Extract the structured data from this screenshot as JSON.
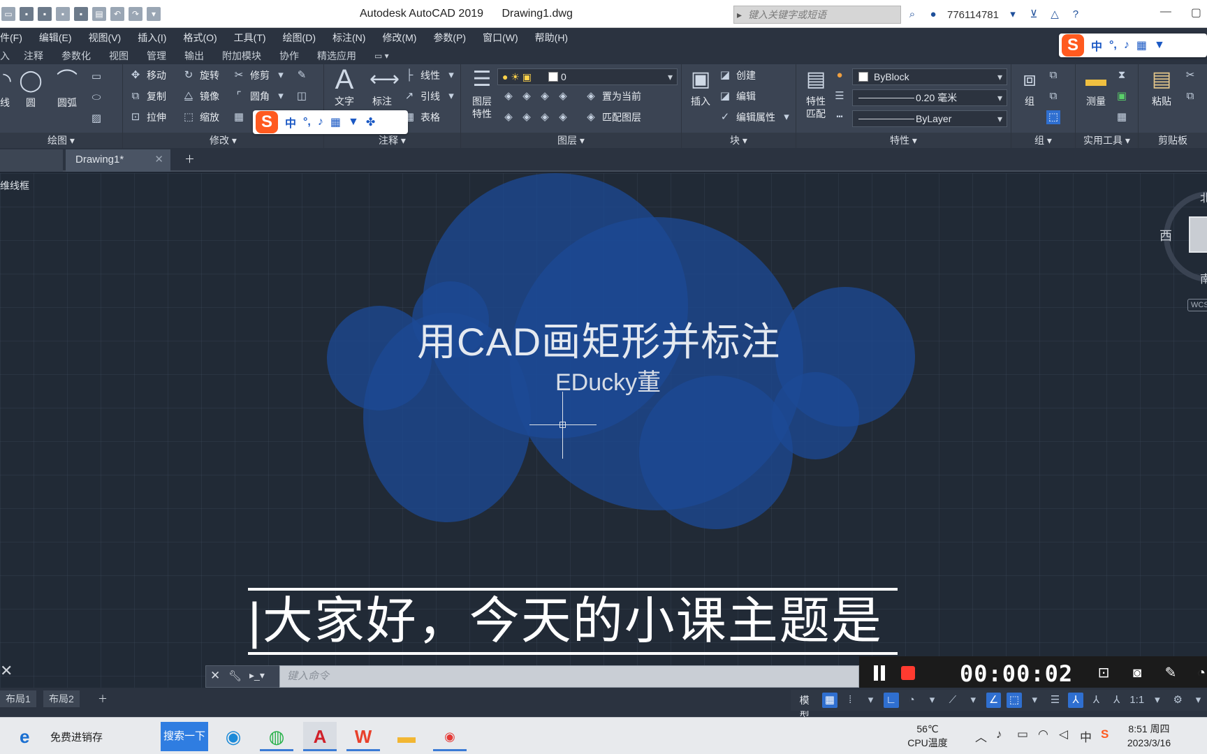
{
  "window": {
    "app_title": "Autodesk AutoCAD 2019",
    "file_name": "Drawing1.dwg",
    "search_placeholder": "键入关键字或短语",
    "user_id": "776114781"
  },
  "menu": [
    "件(F)",
    "编辑(E)",
    "视图(V)",
    "插入(I)",
    "格式(O)",
    "工具(T)",
    "绘图(D)",
    "标注(N)",
    "修改(M)",
    "参数(P)",
    "窗口(W)",
    "帮助(H)"
  ],
  "ribbon_tabs": [
    "入",
    "注释",
    "参数化",
    "视图",
    "管理",
    "输出",
    "附加模块",
    "协作",
    "精选应用"
  ],
  "ribbon": {
    "draw": {
      "title": "绘图",
      "line": "线",
      "circle": "圆",
      "arc": "圆弧"
    },
    "modify": {
      "title": "修改",
      "move": "移动",
      "rotate": "旋转",
      "trim": "修剪",
      "copy": "复制",
      "mirror": "镜像",
      "fillet": "圆角",
      "stretch": "拉伸",
      "scale": "缩放"
    },
    "annotation": {
      "title": "注释",
      "text": "文字",
      "dimension": "标注",
      "linear": "线性",
      "leader": "引线",
      "table": "表格"
    },
    "layers": {
      "title": "图层",
      "layer_props_1": "图层",
      "layer_props_2": "特性",
      "layer_value": "0",
      "set_current": "置为当前",
      "match_layer": "匹配图层"
    },
    "block": {
      "title": "块",
      "insert": "插入",
      "create": "创建",
      "edit": "编辑",
      "edit_attr": "编辑属性"
    },
    "properties": {
      "title": "特性",
      "match_1": "特性",
      "match_2": "匹配",
      "color": "ByBlock",
      "lineweight": "0.20 毫米",
      "linetype": "ByLayer"
    },
    "groups": {
      "title": "组",
      "group": "组"
    },
    "utilities": {
      "title": "实用工具",
      "measure": "测量"
    },
    "clipboard": {
      "title": "剪贴板",
      "paste": "粘贴"
    }
  },
  "ime": {
    "lang": "中",
    "punct": "°,"
  },
  "doc_tabs": {
    "active": "Drawing1*"
  },
  "canvas": {
    "viewport_label": "维线框",
    "title": "用CAD画矩形并标注",
    "author": "EDucky董",
    "subtitle": "|大家好，今天的小课主题是",
    "viewcube": {
      "north": "北",
      "west": "西",
      "south": "南",
      "wcs": "WCS"
    }
  },
  "recorder": {
    "time": "00:00:02"
  },
  "command": {
    "placeholder": "键入命令"
  },
  "layout_tabs": [
    "布局1",
    "布局2"
  ],
  "status": {
    "model": "模型",
    "scale": "1:1"
  },
  "taskbar": {
    "browser_text": "免费进销存",
    "search_button": "搜索一下",
    "temperature": "56℃",
    "temperature_label": "CPU温度",
    "ime_tray": "中",
    "time": "8:51 周四",
    "date": "2023/3/16"
  }
}
